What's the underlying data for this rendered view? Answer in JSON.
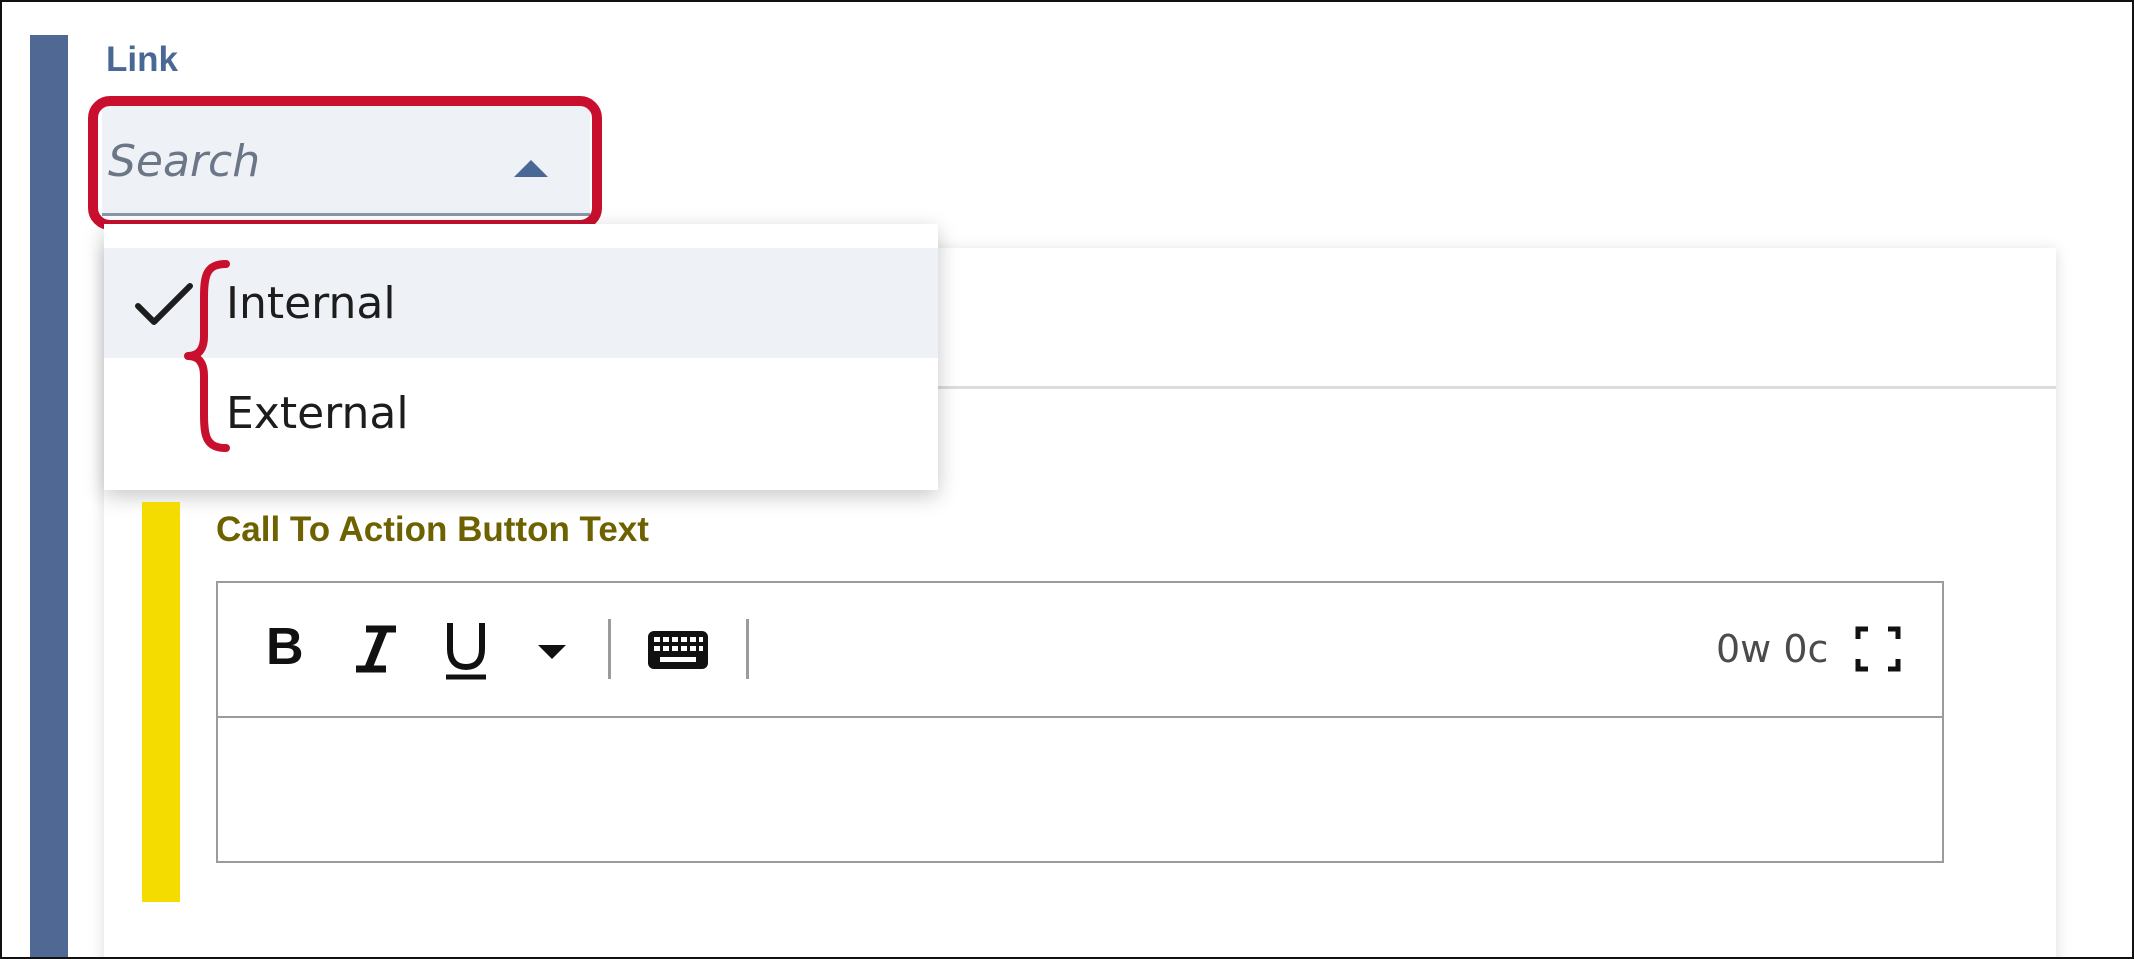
{
  "link_field": {
    "label": "Link",
    "search_placeholder": "Search",
    "options": [
      {
        "label": "Internal",
        "selected": true
      },
      {
        "label": "External",
        "selected": false
      }
    ]
  },
  "cta_field": {
    "label": "Call To Action Button Text"
  },
  "editor": {
    "toolbar": {
      "bold_label": "B",
      "counter": "0w 0c"
    },
    "icons": [
      "italic-icon",
      "underline-icon",
      "caret-down-icon",
      "keyboard-icon",
      "fullscreen-icon"
    ]
  },
  "colors": {
    "section_bar": "#4f6894",
    "label_blue": "#4a6896",
    "annotation_red": "#c8102e",
    "required_bar": "#f5dc00",
    "cta_label": "#6e6200"
  }
}
